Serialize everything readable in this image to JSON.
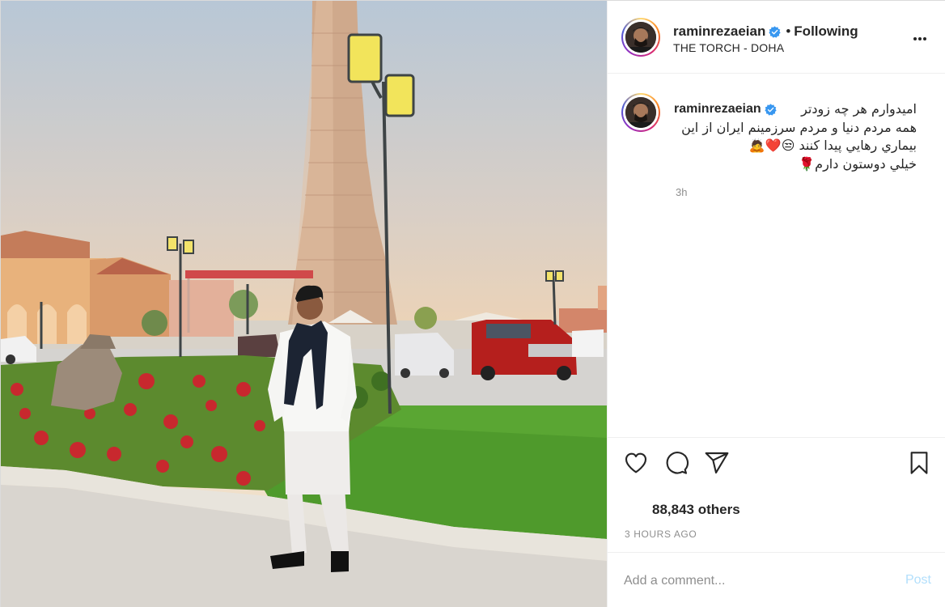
{
  "header": {
    "username": "raminrezaeian",
    "separator": "•",
    "follow_status": "Following",
    "location": "THE TORCH - DOHA"
  },
  "caption": {
    "username": "raminrezaeian",
    "lines": [
      "اميدوارم هر چه زودتر",
      "همه مردم دنيا و مردم سرزمينم ايران از اين",
      "بيماري رهايي پيدا كنند 😒❤️🙇",
      "خيلي دوستون دارم🌹"
    ],
    "time": "3h"
  },
  "likes": {
    "text": "88,843 others"
  },
  "timestamp": "3 HOURS AGO",
  "comment": {
    "placeholder": "Add a comment...",
    "post_label": "Post"
  },
  "colors": {
    "verified": "#3897f0",
    "post_disabled": "#b2dffc",
    "muted": "#8e8e8e",
    "border": "#efefef"
  },
  "icons": [
    "heart-icon",
    "comment-icon",
    "share-icon",
    "bookmark-icon",
    "more-icon",
    "verified-icon"
  ]
}
